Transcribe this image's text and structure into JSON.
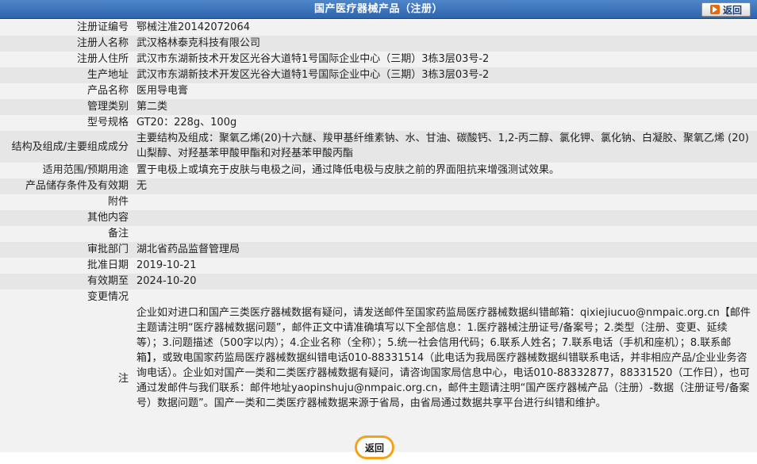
{
  "header": {
    "title": "国产医疗器械产品（注册）",
    "back_label": "返回"
  },
  "rows": [
    {
      "label": "注册证编号",
      "value": "鄂械注准20142072064"
    },
    {
      "label": "注册人名称",
      "value": "武汉格林泰克科技有限公司"
    },
    {
      "label": "注册人住所",
      "value": "武汉市东湖新技术开发区光谷大道特1号国际企业中心（三期）3栋3层03号-2"
    },
    {
      "label": "生产地址",
      "value": "武汉市东湖新技术开发区光谷大道特1号国际企业中心（三期）3栋3层03号-2"
    },
    {
      "label": "产品名称",
      "value": "医用导电膏"
    },
    {
      "label": "管理类别",
      "value": "第二类"
    },
    {
      "label": "型号规格",
      "value": "GT20：228g、100g"
    },
    {
      "label": "结构及组成/主要组成成分",
      "value": "主要结构及组成：聚氧乙烯(20)十六醚、羧甲基纤维素钠、水、甘油、碳酸钙、1,2-丙二醇、氯化钾、氯化钠、白凝胶、聚氧乙烯 (20) 山梨醇、对羟基苯甲酸甲酯和对羟基苯甲酸丙酯"
    },
    {
      "label": "适用范围/预期用途",
      "value": "置于电极上或填充于皮肤与电极之间，通过降低电极与皮肤之前的界面阻抗来增强测试效果。"
    },
    {
      "label": "产品储存条件及有效期",
      "value": "无"
    },
    {
      "label": "附件",
      "value": ""
    },
    {
      "label": "其他内容",
      "value": ""
    },
    {
      "label": "备注",
      "value": ""
    },
    {
      "label": "审批部门",
      "value": "湖北省药品监督管理局"
    },
    {
      "label": "批准日期",
      "value": "2019-10-21"
    },
    {
      "label": "有效期至",
      "value": "2024-10-20"
    },
    {
      "label": "变更情况",
      "value": ""
    }
  ],
  "note": {
    "label": "注",
    "text": "企业如对进口和国产三类医疗器械数据有疑问，请发送邮件至国家药监局医疗器械数据纠错邮箱：qixiejiucuo@nmpaic.org.cn【邮件主题请注明“医疗器械数据问题”，邮件正文中请准确填写以下全部信息：1.医疗器械注册证号/备案号；2.类型（注册、变更、延续等）；3.问题描述（500字以内）；4.企业名称（全称）；5.统一社会信用代码；6.联系人姓名；7.联系电话（手机和座机）；8.联系邮箱】，或致电国家药监局医疗器械数据纠错电话010-88331514（此电话为我局医疗器械数据纠错联系电话，并非相应产品/企业业务咨询电话）。企业如对国产一类和二类医疗器械数据有疑问，请咨询国家局信息中心，电话010-88332877，88331520（工作日），也可通过发邮件与我们联系：邮件地址yaopinshuju@nmpaic.org.cn，邮件主题请注明“国产医疗器械产品（注册）-数据（注册证号/备案号）数据问题”。国产一类和二类医疗器械数据来源于省局，由省局通过数据共享平台进行纠错和维护。"
  },
  "footer": {
    "back_label": "返回"
  }
}
